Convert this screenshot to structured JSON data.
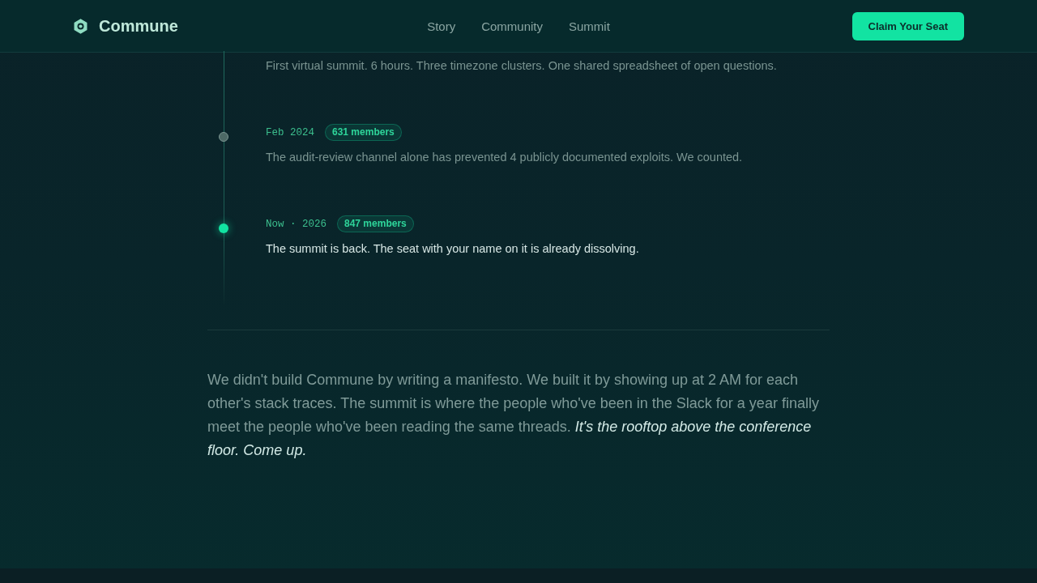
{
  "header": {
    "brand": "Commune",
    "nav": [
      "Story",
      "Community",
      "Summit"
    ],
    "cta": "Claim Your Seat"
  },
  "timeline": [
    {
      "current": false,
      "description": "First virtual summit. 6 hours. Three timezone clusters. One shared spreadsheet of open questions."
    },
    {
      "date": "Feb 2024",
      "members": "631 members",
      "current": false,
      "description": "The audit-review channel alone has prevented 4 publicly documented exploits. We counted."
    },
    {
      "date": "Now · 2026",
      "members": "847 members",
      "current": true,
      "description": "The summit is back. The seat with your name on it is already dissolving."
    }
  ],
  "closing": "We didn't build Commune by writing a manifesto. We built it by showing up at 2 AM for each other's stack traces. The summit is where the people who've been in the Slack for a year finally meet the people who've been reading the same threads. *It's the rooftop above the conference floor. Come up.*"
}
